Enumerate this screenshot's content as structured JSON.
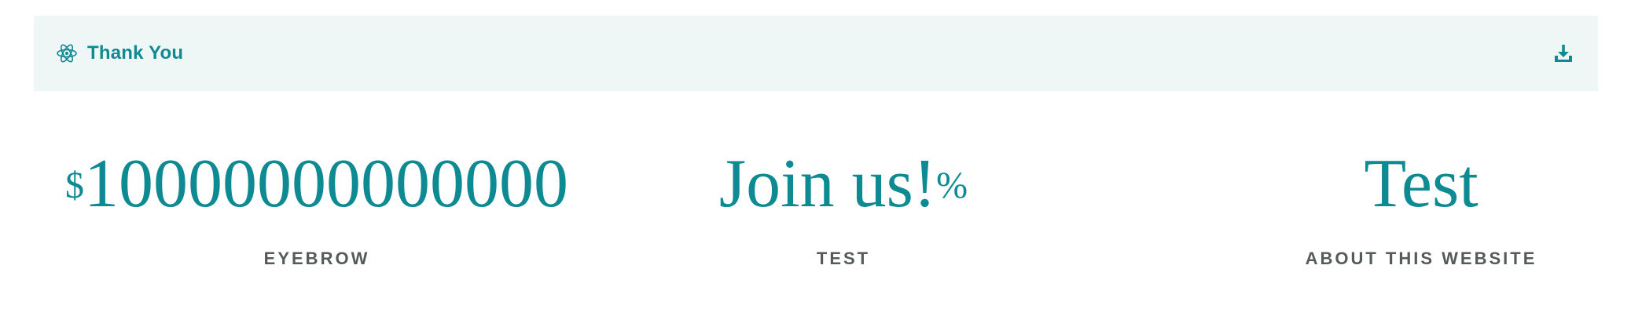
{
  "banner": {
    "title": "Thank You",
    "icon": "atom-icon",
    "action_icon": "download-icon",
    "background": "#eff7f6",
    "accent": "#0e8a92"
  },
  "stats": [
    {
      "prefix": "$",
      "value": "10000000000000",
      "suffix": "",
      "label": "EYEBROW"
    },
    {
      "prefix": "",
      "value": "Join us!",
      "suffix": "%",
      "label": "TEST"
    },
    {
      "prefix": "",
      "value": "Test",
      "suffix": "",
      "label": "ABOUT THIS WEBSITE"
    }
  ],
  "colors": {
    "value": "#0e8a92",
    "label": "#555a5a"
  }
}
